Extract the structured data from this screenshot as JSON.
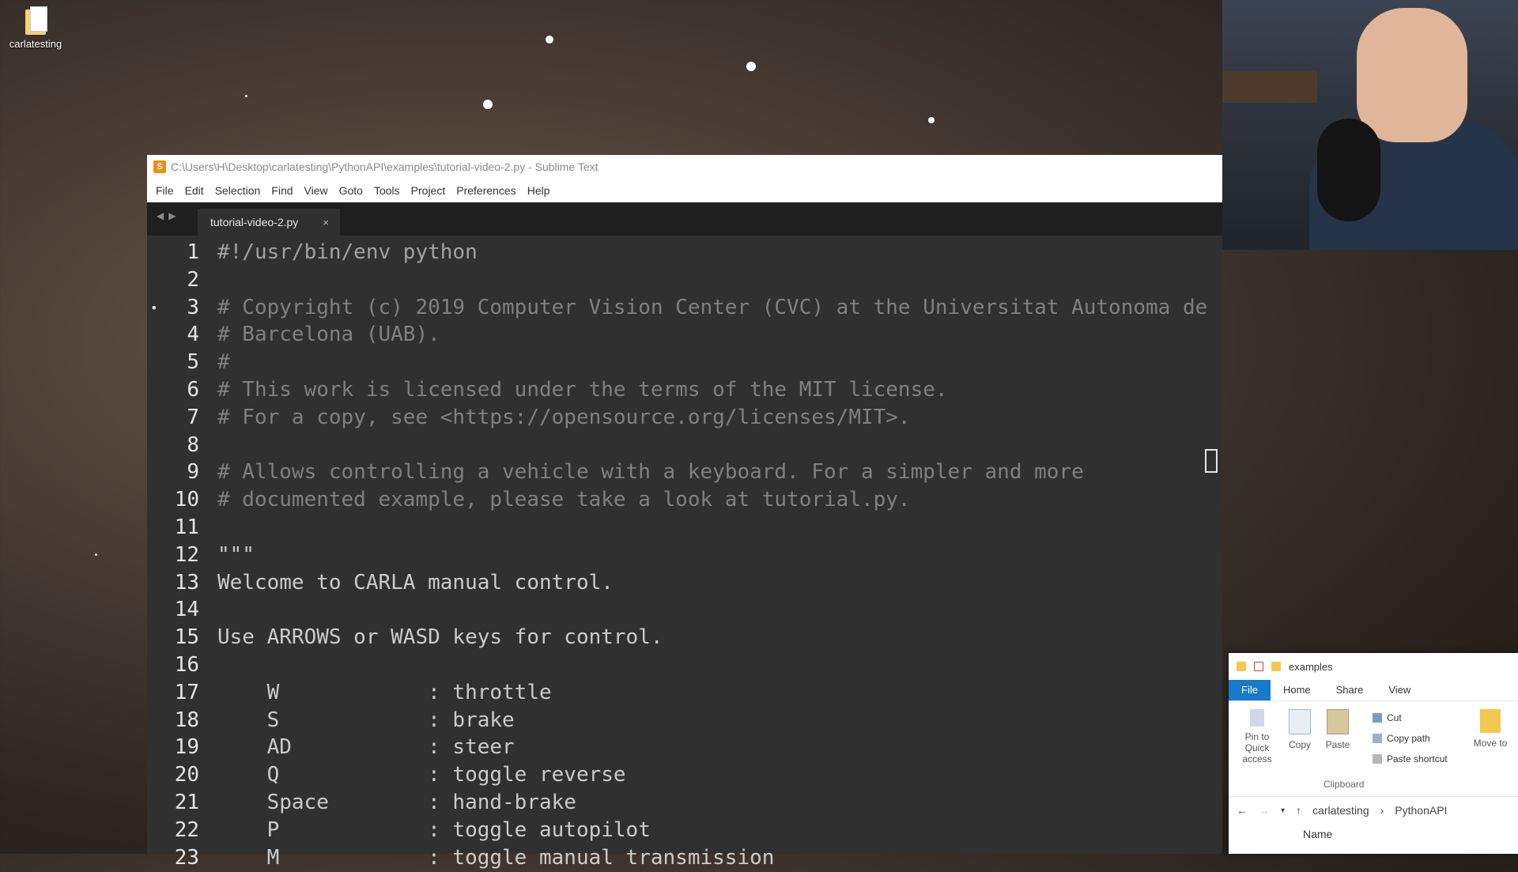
{
  "desktop": {
    "icon_label": "carlatesting"
  },
  "sublime": {
    "title": "C:\\Users\\H\\Desktop\\carlatesting\\PythonAPI\\examples\\tutorial-video-2.py - Sublime Text",
    "menu": [
      "File",
      "Edit",
      "Selection",
      "Find",
      "View",
      "Goto",
      "Tools",
      "Project",
      "Preferences",
      "Help"
    ],
    "tab_name": "tutorial-video-2.py",
    "tab_close": "×",
    "nav_arrows": "◀▶",
    "lines": [
      {
        "n": "1",
        "text": "#!/usr/bin/env python",
        "style": "c-shebang"
      },
      {
        "n": "2",
        "text": "",
        "style": "c-comment"
      },
      {
        "n": "3",
        "text": "# Copyright (c) 2019 Computer Vision Center (CVC) at the Universitat Autonoma de",
        "style": "c-comment",
        "dot": "•"
      },
      {
        "n": "4",
        "text": "# Barcelona (UAB).",
        "style": "c-comment"
      },
      {
        "n": "5",
        "text": "#",
        "style": "c-comment"
      },
      {
        "n": "6",
        "text": "# This work is licensed under the terms of the MIT license.",
        "style": "c-comment"
      },
      {
        "n": "7",
        "text": "# For a copy, see <https://opensource.org/licenses/MIT>.",
        "style": "c-comment"
      },
      {
        "n": "8",
        "text": "",
        "style": "c-comment"
      },
      {
        "n": "9",
        "text": "# Allows controlling a vehicle with a keyboard. For a simpler and more",
        "style": "c-comment"
      },
      {
        "n": "10",
        "text": "# documented example, please take a look at tutorial.py.",
        "style": "c-comment"
      },
      {
        "n": "11",
        "text": "",
        "style": "c-comment"
      },
      {
        "n": "12",
        "text": "\"\"\"",
        "style": "c-str"
      },
      {
        "n": "13",
        "text": "Welcome to CARLA manual control.",
        "style": "c-str"
      },
      {
        "n": "14",
        "text": "",
        "style": "c-str"
      },
      {
        "n": "15",
        "text": "Use ARROWS or WASD keys for control.",
        "style": "c-str"
      },
      {
        "n": "16",
        "text": "",
        "style": "c-str"
      },
      {
        "n": "17",
        "text": "    W            : throttle",
        "style": "c-str"
      },
      {
        "n": "18",
        "text": "    S            : brake",
        "style": "c-str"
      },
      {
        "n": "19",
        "text": "    AD           : steer",
        "style": "c-str"
      },
      {
        "n": "20",
        "text": "    Q            : toggle reverse",
        "style": "c-str"
      },
      {
        "n": "21",
        "text": "    Space        : hand-brake",
        "style": "c-str"
      },
      {
        "n": "22",
        "text": "    P            : toggle autopilot",
        "style": "c-str"
      },
      {
        "n": "23",
        "text": "    M            : toggle manual transmission",
        "style": "c-str"
      }
    ]
  },
  "explorer": {
    "title": "examples",
    "tabs": [
      "File",
      "Home",
      "Share",
      "View"
    ],
    "ribbon": {
      "pin": "Pin to Quick access",
      "copy": "Copy",
      "paste": "Paste",
      "cut": "Cut",
      "copy_path": "Copy path",
      "paste_shortcut": "Paste shortcut",
      "move_to": "Move to",
      "group": "Clipboard"
    },
    "breadcrumb": [
      "carlatesting",
      "PythonAPI"
    ],
    "column": "Name"
  },
  "colors": {
    "editor_bg": "#303030",
    "tab_bar_bg": "#1f1f1f",
    "accent": "#1979ca"
  }
}
